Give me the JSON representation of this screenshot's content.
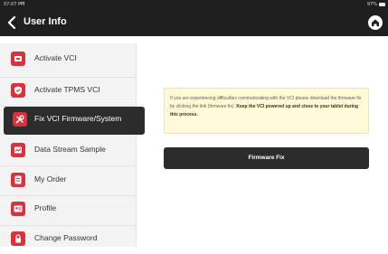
{
  "status": {
    "time": "07:07 PM",
    "battery": "97%"
  },
  "header": {
    "title": "User Info"
  },
  "sidebar": {
    "items": [
      {
        "label": "Activate VCI",
        "icon": "vci-icon"
      },
      {
        "label": "Activate TPMS VCI",
        "icon": "tpms-shield-icon"
      },
      {
        "label": "Fix VCI Firmware/System",
        "icon": "tools-icon",
        "active": true
      },
      {
        "label": "Data Stream Sample",
        "icon": "data-stream-icon"
      },
      {
        "label": "My Order",
        "icon": "order-icon"
      },
      {
        "label": "Profile",
        "icon": "profile-icon"
      },
      {
        "label": "Change Password",
        "icon": "lock-icon"
      }
    ]
  },
  "main": {
    "notice_text": "If you are experiencing difficulties communicating with the VCI please download the firmware fix by clicking the link (firmware fix).",
    "notice_bold": "Keep the VCI powered up and close to your tablet during this process.",
    "button_label": "Firmware Fix"
  },
  "colors": {
    "accent": "#d6333c",
    "dark": "#2c2c2c",
    "notice_bg": "#fffbd9"
  }
}
